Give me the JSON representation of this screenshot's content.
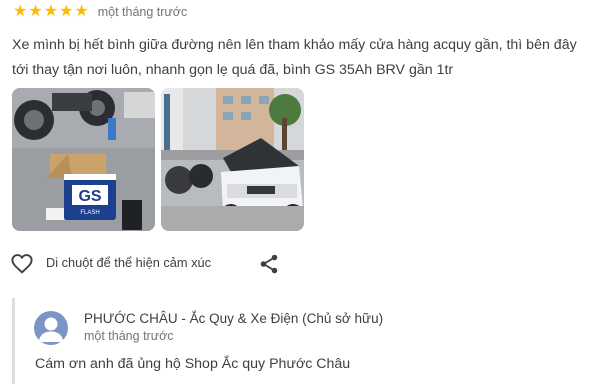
{
  "review": {
    "rating_value": 5,
    "stars": [
      "★",
      "★",
      "★",
      "★",
      "★"
    ],
    "date": "một tháng trước",
    "text": "Xe mình bị hết bình giữa đường nên lên tham khảo mấy cửa hàng acquy gần, thì bên đây tới thay tận nơi luôn, nhanh gọn lẹ quá đã, bình GS 35Ah BRV gần 1tr",
    "photos": [
      {
        "icon": "battery-photo",
        "battery_brand": "GS",
        "battery_sub": "FLASH"
      },
      {
        "icon": "car-hood-photo"
      }
    ],
    "react_label": "Di chuột để thể hiện cảm xúc"
  },
  "reply": {
    "owner_name": "PHƯỚC CHÂU - Ắc Quy & Xe Điện (Chủ sở hữu)",
    "date": "một tháng trước",
    "text": "Cám ơn anh đã ủng hộ Shop Ắc quy Phước Châu"
  },
  "colors": {
    "star": "#fbbc04",
    "text": "#3c4043",
    "muted": "#70757a",
    "avatar": "#7b95c8",
    "reply_border": "#dadce0"
  }
}
